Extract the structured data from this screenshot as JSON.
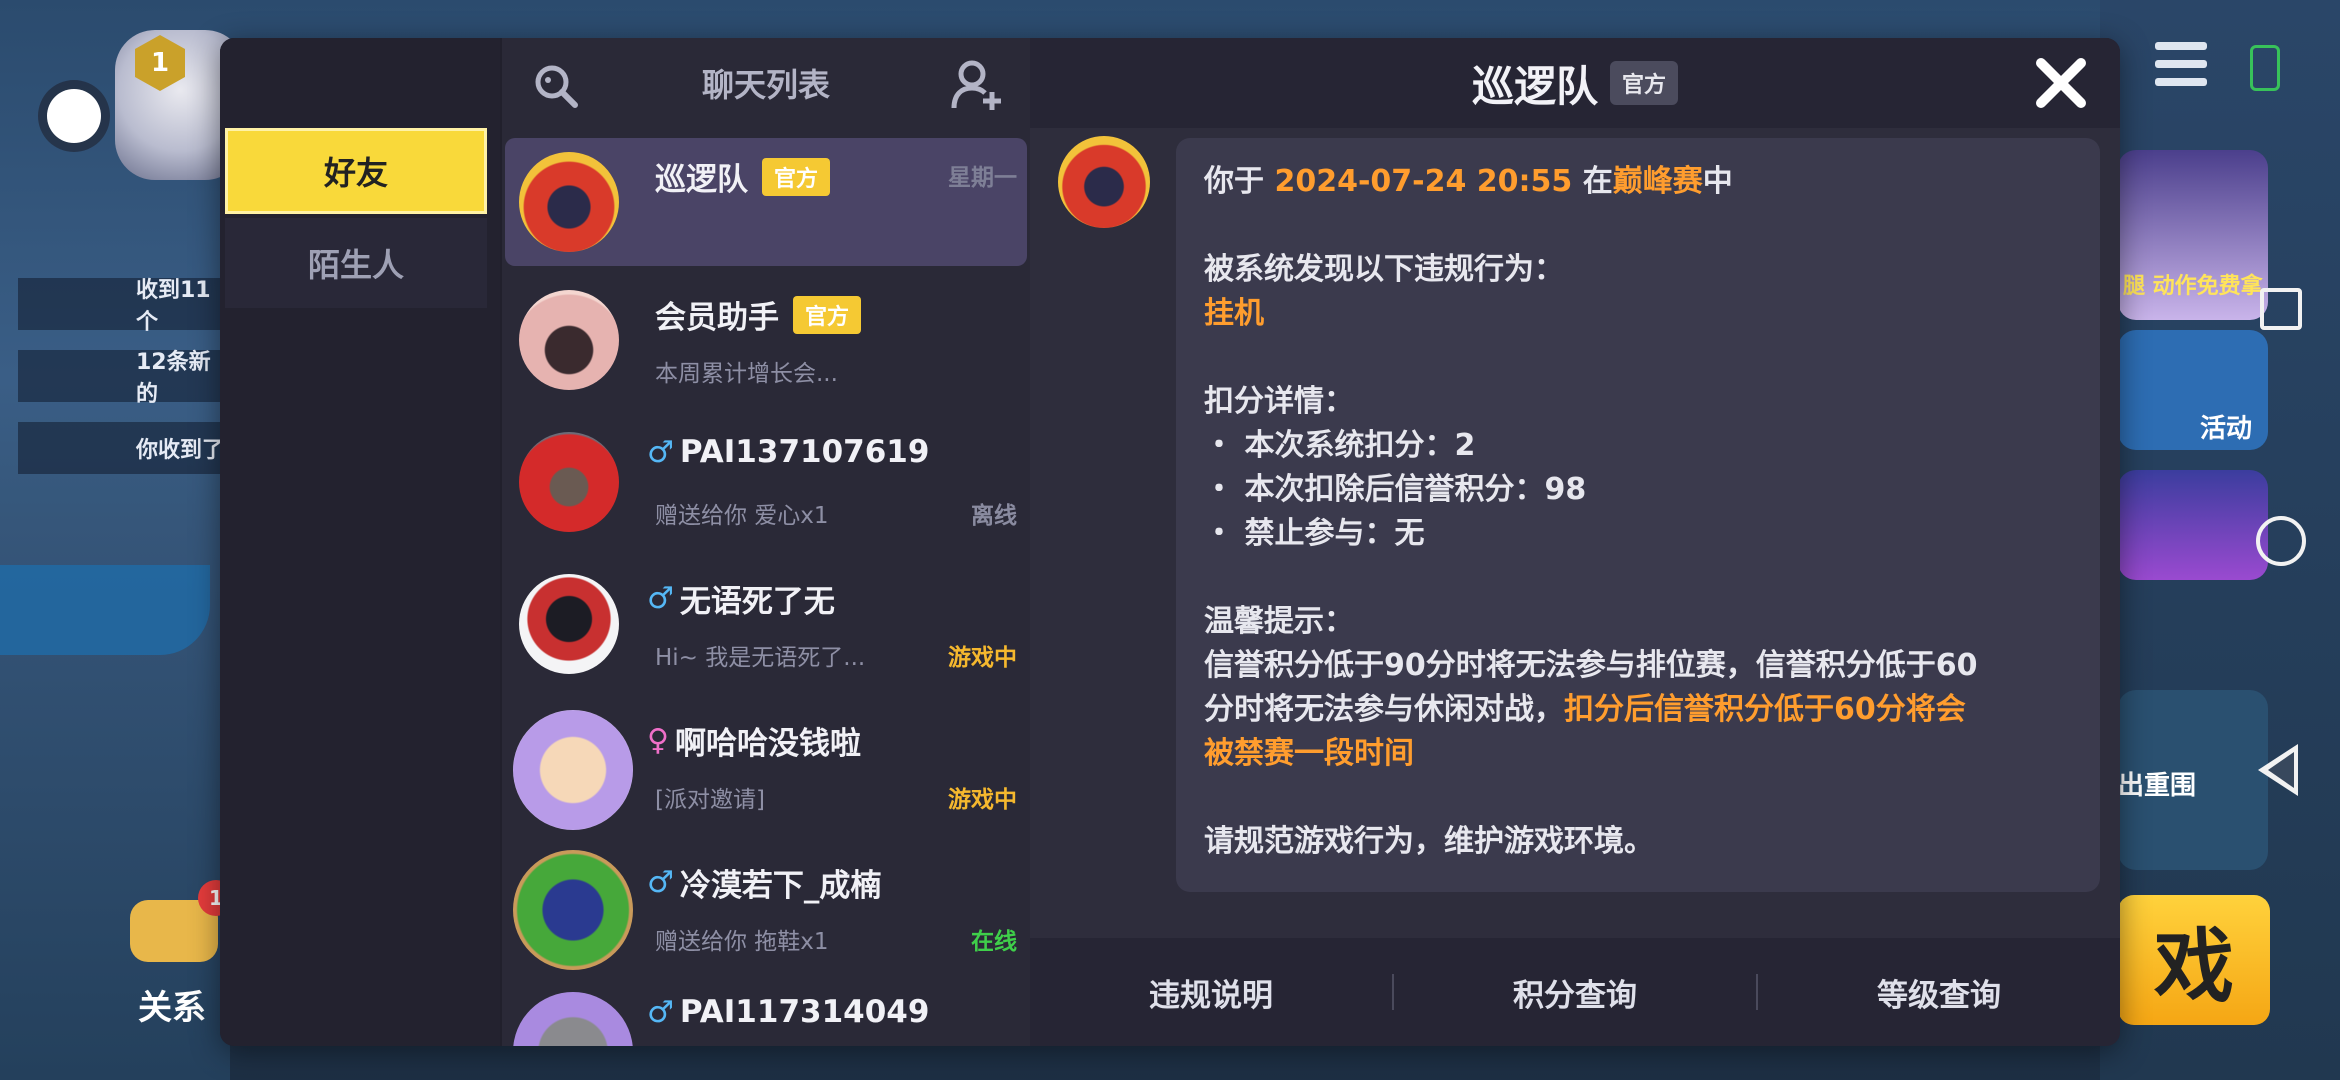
{
  "background": {
    "side_notifications": [
      "收到11个",
      "12条新的",
      "你收到了"
    ],
    "rank_badge": "1",
    "relation": {
      "label": "关系",
      "badge": "1"
    },
    "right_cards": [
      {
        "label": "腿 动作免费拿"
      },
      {
        "label": "活动"
      },
      {
        "label": "出重围"
      }
    ],
    "play_button_label": "戏"
  },
  "tabs": {
    "friends": "好友",
    "strangers": "陌生人"
  },
  "chat_list": {
    "title": "聊天列表",
    "items": [
      {
        "name": "巡逻队",
        "official": "官方",
        "time": "星期一",
        "preview": "",
        "status": ""
      },
      {
        "name": "会员助手",
        "official": "官方",
        "time": "",
        "preview": "本周累计增长会...",
        "status": ""
      },
      {
        "name": "PAI137107619",
        "gender": "♂",
        "preview": "赠送给你 爱心x1",
        "status": "离线",
        "status_color": "#8a8ba0"
      },
      {
        "name": "无语死了无",
        "gender": "♂",
        "preview": "Hi~ 我是无语死了...",
        "status": "游戏中",
        "status_color": "#f5b82e"
      },
      {
        "name": "啊哈哈没钱啦",
        "gender": "♀",
        "preview": "[派对邀请]",
        "status": "游戏中",
        "status_color": "#f5b82e"
      },
      {
        "name": "冷漠若下_成楠",
        "gender": "♂",
        "preview": "赠送给你 拖鞋x1",
        "status": "在线",
        "status_color": "#3fcf4a"
      },
      {
        "name": "PAI117314049",
        "gender": "♂",
        "preview": "",
        "status": ""
      }
    ]
  },
  "message": {
    "title": "巡逻队",
    "official": "官方",
    "line1_prefix": "你于 ",
    "line1_time": "2024-07-24 20:55",
    "line1_mid": " 在",
    "line1_mode": "巅峰赛",
    "line1_suffix": "中",
    "violation_heading": "被系统发现以下违规行为：",
    "violation": "挂机",
    "deduct_heading": "扣分详情：",
    "deduct_items": [
      "・ 本次系统扣分：2",
      "・ 本次扣除后信誉积分：98",
      "・ 禁止参与：无"
    ],
    "tip_heading": "温馨提示：",
    "tip_line1": "信誉积分低于90分时将无法参与排位赛，信誉积分低于60",
    "tip_line2_plain": "分时将无法参与休闲对战，",
    "tip_line2_hl": "扣分后信誉积分低于60分将会",
    "tip_line3_hl": "被禁赛一段时间",
    "closing": "请规范游戏行为，维护游戏环境。"
  },
  "footer": {
    "rules": "违规说明",
    "points": "积分查询",
    "level": "等级查询"
  },
  "colors": {
    "accent_yellow": "#f9d93a",
    "highlight_orange": "#ff9d2e",
    "dialog_bg": "#21202c"
  }
}
